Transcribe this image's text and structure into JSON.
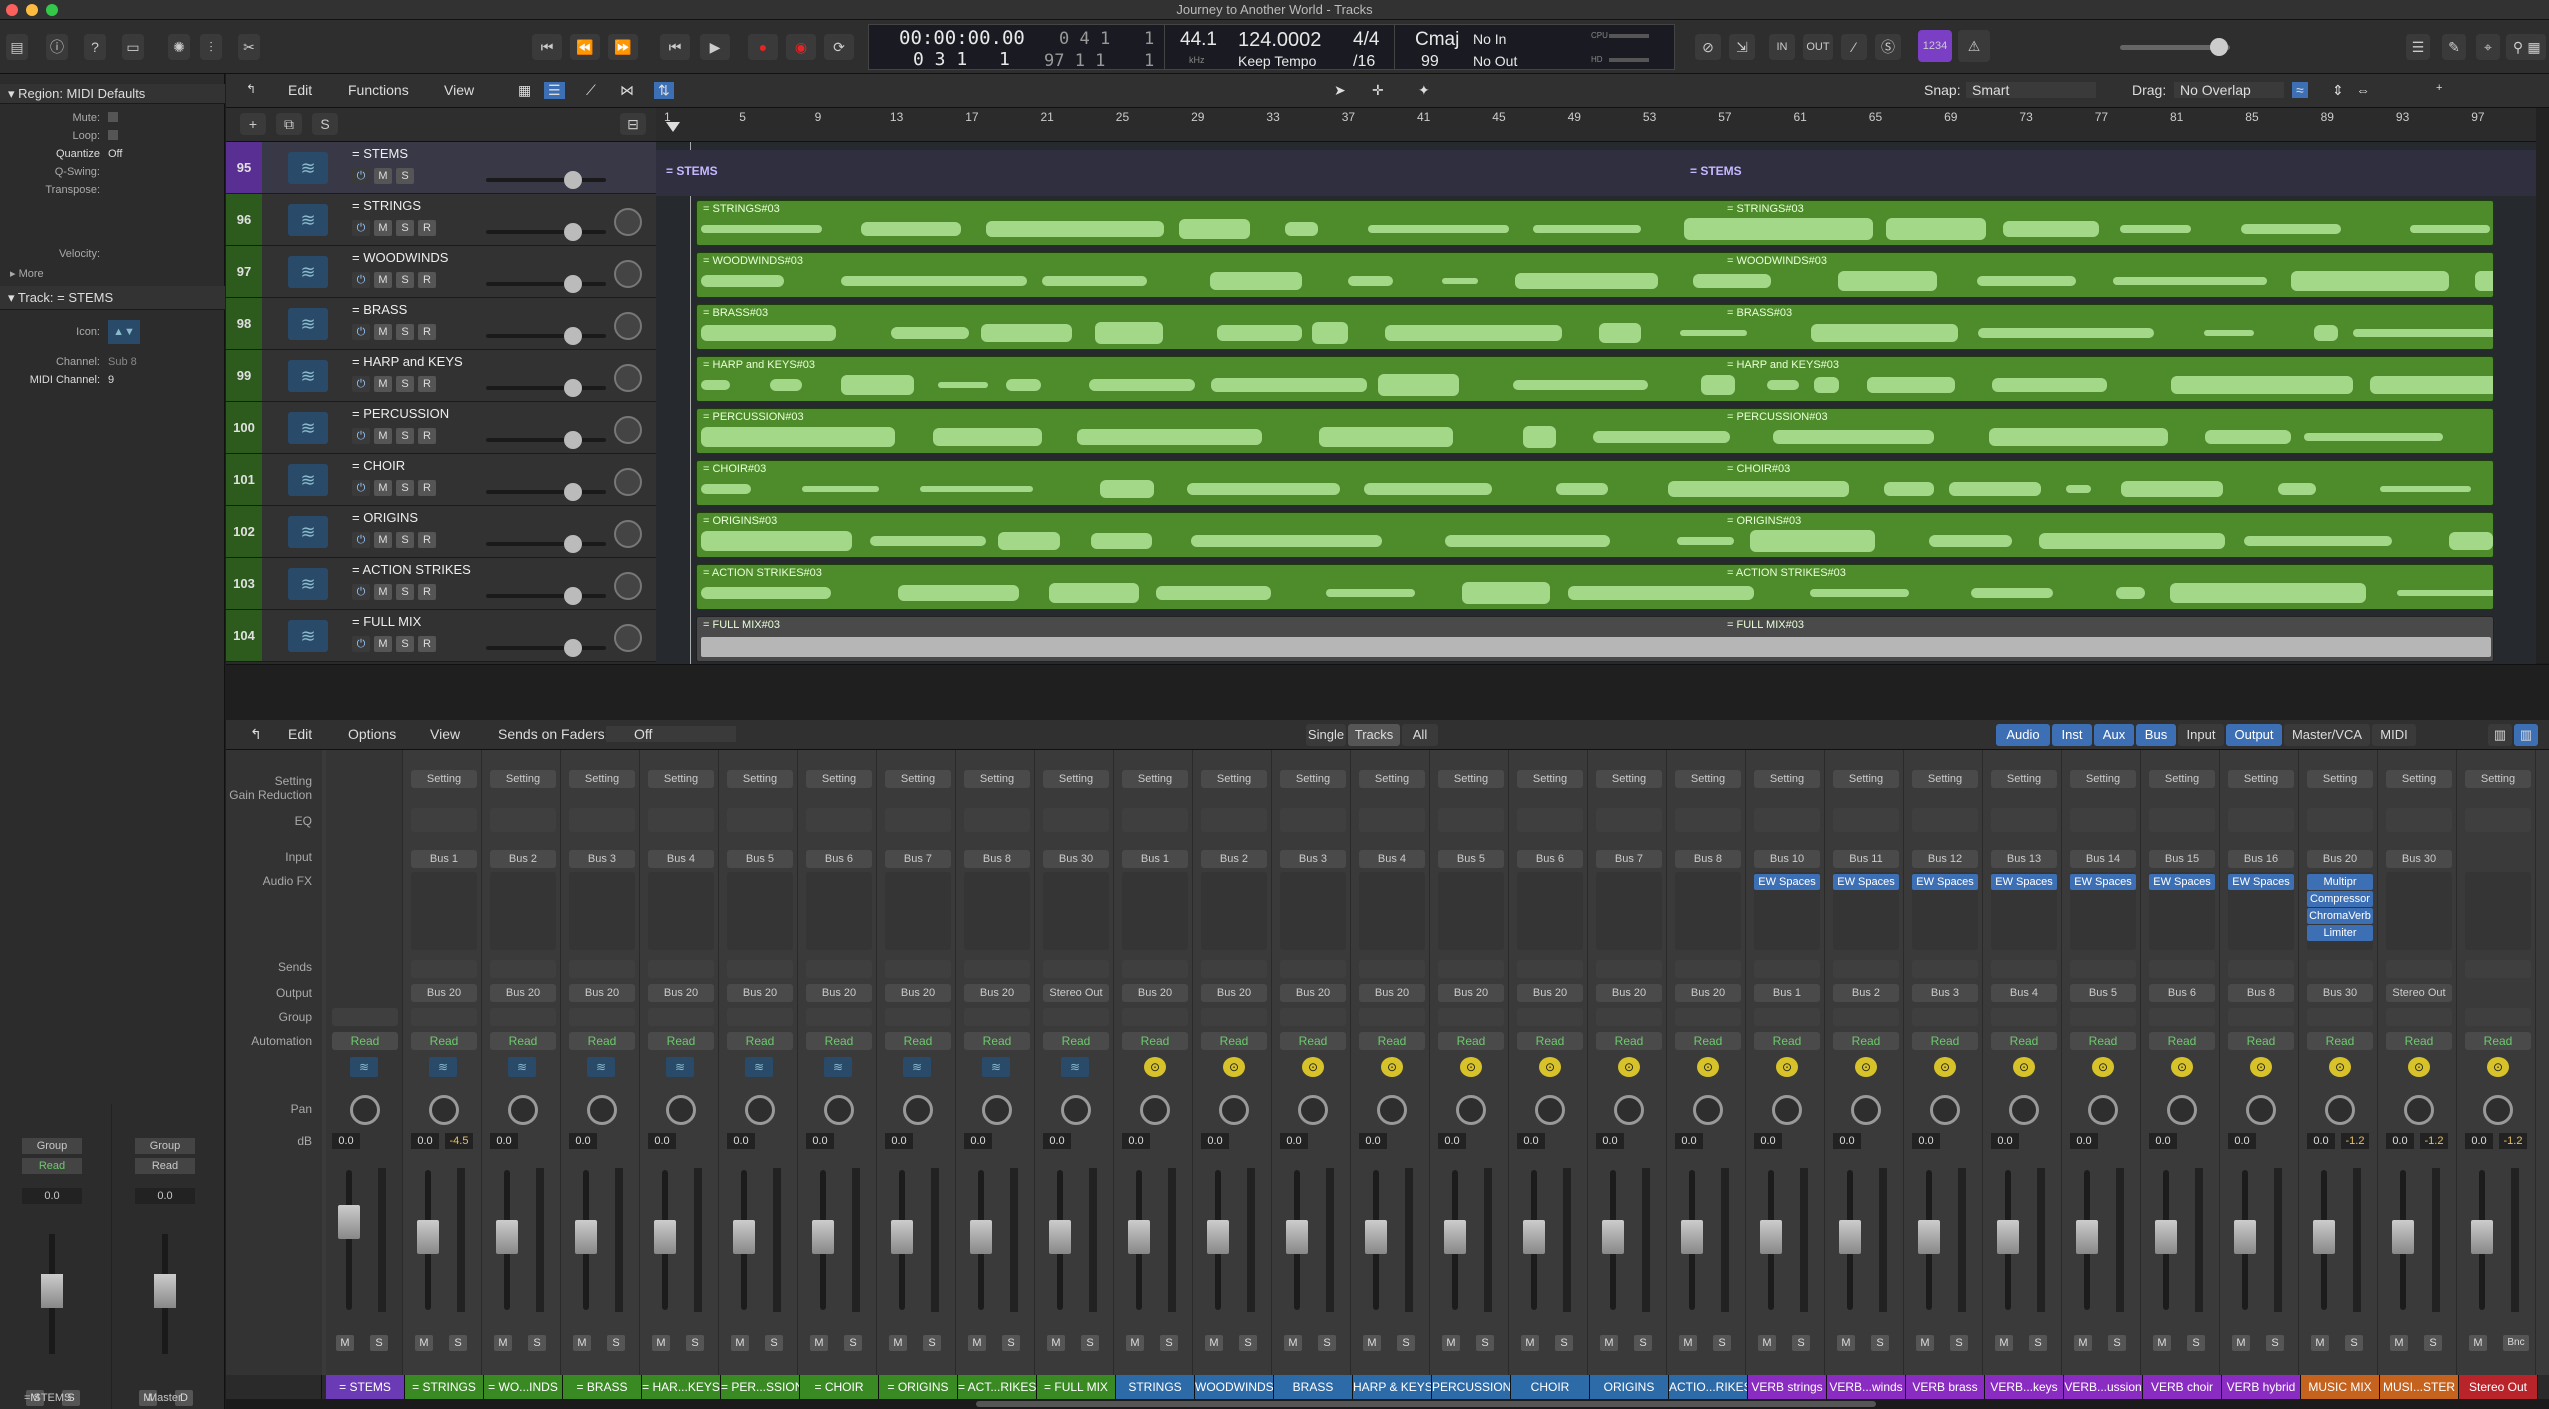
{
  "window": {
    "title": "Journey to Another World - Tracks"
  },
  "lcd": {
    "time": "00:00:00.00",
    "bars_top": "0  4  1",
    "ticks_top": "1",
    "beats": "0  3  1",
    "beat_tick": "1",
    "bars_bottom": "97  1  1",
    "tick_bottom": "1",
    "sample_rate": "44.1",
    "sample_unit": "kHz",
    "tempo": "124.0002",
    "tempo_mode": "Keep Tempo",
    "sig_top": "4/4",
    "sig_bottom": "/16",
    "key": "Cmaj",
    "key_num": "99",
    "in_label": "No In",
    "out_label": "No Out",
    "cpu": "CPU",
    "hd": "HD"
  },
  "toolbar": {
    "in": "IN",
    "out": "OUT",
    "count": "1234"
  },
  "inspector": {
    "region_header": "Region: MIDI Defaults",
    "mute": "Mute:",
    "loop": "Loop:",
    "quantize_label": "Quantize",
    "quantize_value": "Off",
    "qswing": "Q-Swing:",
    "transpose": "Transpose:",
    "velocity": "Velocity:",
    "more": "More",
    "track_header": "Track:",
    "track_name": "= STEMS",
    "icon_label": "Icon:",
    "channel_label": "Channel:",
    "channel_value": "Sub 8",
    "midi_label": "MIDI Channel:",
    "midi_value": "9",
    "strip_a": {
      "group": "Group",
      "read": "Read",
      "db": "0.0",
      "m": "M",
      "s": "S",
      "name": "= STEMS"
    },
    "strip_b": {
      "group": "Group",
      "read": "Read",
      "db": "0.0",
      "m": "M",
      "s": "D",
      "name": "Master"
    }
  },
  "tracks_menu": {
    "edit": "Edit",
    "functions": "Functions",
    "view": "View",
    "snap_label": "Snap:",
    "snap_value": "Smart",
    "drag_label": "Drag:",
    "drag_value": "No Overlap",
    "s": "S"
  },
  "ruler": [
    "1",
    "5",
    "9",
    "13",
    "17",
    "21",
    "25",
    "29",
    "33",
    "37",
    "41",
    "45",
    "49",
    "53",
    "57",
    "61",
    "65",
    "69",
    "73",
    "77",
    "81",
    "85",
    "89",
    "93",
    "97"
  ],
  "tracks": [
    {
      "num": "95",
      "name": "= STEMS"
    },
    {
      "num": "96",
      "name": "= STRINGS"
    },
    {
      "num": "97",
      "name": "= WOODWINDS"
    },
    {
      "num": "98",
      "name": "= BRASS"
    },
    {
      "num": "99",
      "name": "= HARP and KEYS"
    },
    {
      "num": "100",
      "name": "= PERCUSSION"
    },
    {
      "num": "101",
      "name": "= CHOIR"
    },
    {
      "num": "102",
      "name": "= ORIGINS"
    },
    {
      "num": "103",
      "name": "= ACTION STRIKES"
    },
    {
      "num": "104",
      "name": "= FULL MIX"
    }
  ],
  "track_buttons": {
    "m": "M",
    "s": "S",
    "r": "R"
  },
  "regions": [
    {
      "label": "= STEMS",
      "label2": "= STEMS"
    },
    {
      "label": "= STRINGS#03",
      "label2": "= STRINGS#03"
    },
    {
      "label": "= WOODWINDS#03",
      "label2": "= WOODWINDS#03"
    },
    {
      "label": "= BRASS#03",
      "label2": "= BRASS#03"
    },
    {
      "label": "= HARP and KEYS#03",
      "label2": "= HARP and KEYS#03"
    },
    {
      "label": "= PERCUSSION#03",
      "label2": "= PERCUSSION#03"
    },
    {
      "label": "= CHOIR#03",
      "label2": "= CHOIR#03"
    },
    {
      "label": "= ORIGINS#03",
      "label2": "= ORIGINS#03"
    },
    {
      "label": "= ACTION STRIKES#03",
      "label2": "= ACTION STRIKES#03"
    },
    {
      "label": "= FULL MIX#03",
      "label2": "= FULL MIX#03"
    }
  ],
  "mixer_menu": {
    "edit": "Edit",
    "options": "Options",
    "view": "View",
    "sends_label": "Sends on Faders:",
    "sends_value": "Off",
    "single": "Single",
    "tracks": "Tracks",
    "all": "All",
    "audio": "Audio",
    "inst": "Inst",
    "aux": "Aux",
    "bus": "Bus",
    "input": "Input",
    "output": "Output",
    "mastervca": "Master/VCA",
    "midi": "MIDI"
  },
  "mixer_labels": {
    "setting": "Setting",
    "gain": "Gain Reduction",
    "eq": "EQ",
    "input": "Input",
    "audiofx": "Audio FX",
    "sends": "Sends",
    "output": "Output",
    "group": "Group",
    "automation": "Automation",
    "pan": "Pan",
    "db": "dB"
  },
  "strips": [
    {
      "input": "",
      "fx": [],
      "output": "",
      "read": "Read",
      "db": "0.0",
      "peak": "",
      "name": "= STEMS",
      "color": "#6b3bb5",
      "m": "M",
      "s": "S"
    },
    {
      "input": "Bus 1",
      "fx": [],
      "output": "Bus 20",
      "read": "Read",
      "db": "0.0",
      "peak": "-4.5",
      "name": "= STRINGS",
      "color": "#3a8a24",
      "m": "M",
      "s": "S"
    },
    {
      "input": "Bus 2",
      "fx": [],
      "output": "Bus 20",
      "read": "Read",
      "db": "0.0",
      "peak": "",
      "name": "= WO...INDS",
      "color": "#3a8a24",
      "m": "M",
      "s": "S"
    },
    {
      "input": "Bus 3",
      "fx": [],
      "output": "Bus 20",
      "read": "Read",
      "db": "0.0",
      "peak": "",
      "name": "= BRASS",
      "color": "#3a8a24",
      "m": "M",
      "s": "S"
    },
    {
      "input": "Bus 4",
      "fx": [],
      "output": "Bus 20",
      "read": "Read",
      "db": "0.0",
      "peak": "",
      "name": "= HAR...KEYS",
      "color": "#3a8a24",
      "m": "M",
      "s": "S"
    },
    {
      "input": "Bus 5",
      "fx": [],
      "output": "Bus 20",
      "read": "Read",
      "db": "0.0",
      "peak": "",
      "name": "= PER...SSION",
      "color": "#3a8a24",
      "m": "M",
      "s": "S"
    },
    {
      "input": "Bus 6",
      "fx": [],
      "output": "Bus 20",
      "read": "Read",
      "db": "0.0",
      "peak": "",
      "name": "= CHOIR",
      "color": "#3a8a24",
      "m": "M",
      "s": "S"
    },
    {
      "input": "Bus 7",
      "fx": [],
      "output": "Bus 20",
      "read": "Read",
      "db": "0.0",
      "peak": "",
      "name": "= ORIGINS",
      "color": "#3a8a24",
      "m": "M",
      "s": "S"
    },
    {
      "input": "Bus 8",
      "fx": [],
      "output": "Bus 20",
      "read": "Read",
      "db": "0.0",
      "peak": "",
      "name": "= ACT...RIKES",
      "color": "#3a8a24",
      "m": "M",
      "s": "S"
    },
    {
      "input": "Bus 30",
      "fx": [],
      "output": "Stereo Out",
      "read": "Read",
      "db": "0.0",
      "peak": "",
      "name": "= FULL MIX",
      "color": "#3a8a24",
      "m": "M",
      "s": "S"
    },
    {
      "input": "Bus 1",
      "fx": [],
      "output": "Bus 20",
      "read": "Read",
      "db": "0.0",
      "peak": "",
      "name": "STRINGS",
      "color": "#2c6aa8",
      "m": "M",
      "s": "S"
    },
    {
      "input": "Bus 2",
      "fx": [],
      "output": "Bus 20",
      "read": "Read",
      "db": "0.0",
      "peak": "",
      "name": "WOODWINDS",
      "color": "#2c6aa8",
      "m": "M",
      "s": "S"
    },
    {
      "input": "Bus 3",
      "fx": [],
      "output": "Bus 20",
      "read": "Read",
      "db": "0.0",
      "peak": "",
      "name": "BRASS",
      "color": "#2c6aa8",
      "m": "M",
      "s": "S"
    },
    {
      "input": "Bus 4",
      "fx": [],
      "output": "Bus 20",
      "read": "Read",
      "db": "0.0",
      "peak": "",
      "name": "HARP & KEYS",
      "color": "#2c6aa8",
      "m": "M",
      "s": "S"
    },
    {
      "input": "Bus 5",
      "fx": [],
      "output": "Bus 20",
      "read": "Read",
      "db": "0.0",
      "peak": "",
      "name": "PERCUSSION",
      "color": "#2c6aa8",
      "m": "M",
      "s": "S"
    },
    {
      "input": "Bus 6",
      "fx": [],
      "output": "Bus 20",
      "read": "Read",
      "db": "0.0",
      "peak": "",
      "name": "CHOIR",
      "color": "#2c6aa8",
      "m": "M",
      "s": "S"
    },
    {
      "input": "Bus 7",
      "fx": [],
      "output": "Bus 20",
      "read": "Read",
      "db": "0.0",
      "peak": "",
      "name": "ORIGINS",
      "color": "#2c6aa8",
      "m": "M",
      "s": "S"
    },
    {
      "input": "Bus 8",
      "fx": [],
      "output": "Bus 20",
      "read": "Read",
      "db": "0.0",
      "peak": "",
      "name": "ACTIO...RIKES",
      "color": "#2c6aa8",
      "m": "M",
      "s": "S"
    },
    {
      "input": "Bus 10",
      "fx": [
        "EW Spaces"
      ],
      "output": "Bus 1",
      "read": "Read",
      "db": "0.0",
      "peak": "",
      "name": "VERB strings",
      "color": "#8a2bc2",
      "m": "M",
      "s": "S"
    },
    {
      "input": "Bus 11",
      "fx": [
        "EW Spaces"
      ],
      "output": "Bus 2",
      "read": "Read",
      "db": "0.0",
      "peak": "",
      "name": "VERB...winds",
      "color": "#8a2bc2",
      "m": "M",
      "s": "S"
    },
    {
      "input": "Bus 12",
      "fx": [
        "EW Spaces"
      ],
      "output": "Bus 3",
      "read": "Read",
      "db": "0.0",
      "peak": "",
      "name": "VERB brass",
      "color": "#8a2bc2",
      "m": "M",
      "s": "S"
    },
    {
      "input": "Bus 13",
      "fx": [
        "EW Spaces"
      ],
      "output": "Bus 4",
      "read": "Read",
      "db": "0.0",
      "peak": "",
      "name": "VERB...keys",
      "color": "#8a2bc2",
      "m": "M",
      "s": "S"
    },
    {
      "input": "Bus 14",
      "fx": [
        "EW Spaces"
      ],
      "output": "Bus 5",
      "read": "Read",
      "db": "0.0",
      "peak": "",
      "name": "VERB...ussion",
      "color": "#8a2bc2",
      "m": "M",
      "s": "S"
    },
    {
      "input": "Bus 15",
      "fx": [
        "EW Spaces"
      ],
      "output": "Bus 6",
      "read": "Read",
      "db": "0.0",
      "peak": "",
      "name": "VERB choir",
      "color": "#8a2bc2",
      "m": "M",
      "s": "S"
    },
    {
      "input": "Bus 16",
      "fx": [
        "EW Spaces"
      ],
      "output": "Bus 8",
      "read": "Read",
      "db": "0.0",
      "peak": "",
      "name": "VERB hybrid",
      "color": "#8a2bc2",
      "m": "M",
      "s": "S"
    },
    {
      "input": "Bus 20",
      "fx": [
        "Multipr",
        "Compressor",
        "ChromaVerb",
        "Limiter"
      ],
      "output": "Bus 30",
      "read": "Read",
      "db": "0.0",
      "peak": "-1.2",
      "name": "MUSIC MIX",
      "color": "#c4621e",
      "m": "M",
      "s": "S"
    },
    {
      "input": "Bus 30",
      "fx": [],
      "output": "Stereo Out",
      "read": "Read",
      "db": "0.0",
      "peak": "-1.2",
      "name": "MUSI...STER",
      "color": "#c4621e",
      "m": "M",
      "s": "S"
    },
    {
      "input": "",
      "fx": [],
      "output": "",
      "read": "Read",
      "db": "0.0",
      "peak": "-1.2",
      "name": "Stereo Out",
      "color": "#b8242a",
      "m": "M",
      "s": "Bnc"
    }
  ],
  "colors": {
    "green": "#4e8c2b",
    "wave": "#a4d889",
    "accent": "#3d6fb5"
  }
}
